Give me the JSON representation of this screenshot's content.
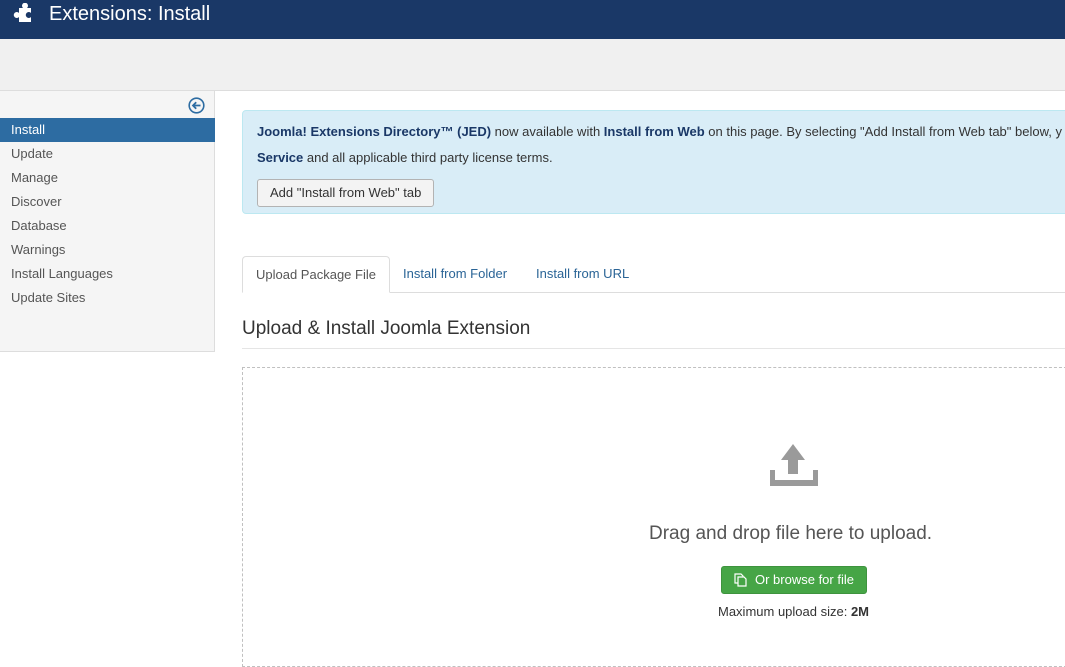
{
  "header": {
    "title": "Extensions: Install",
    "icon": "puzzle-piece-icon"
  },
  "sidebar": {
    "toggle_icon": "collapse-left-icon",
    "items": [
      {
        "label": "Install",
        "active": true
      },
      {
        "label": "Update"
      },
      {
        "label": "Manage"
      },
      {
        "label": "Discover"
      },
      {
        "label": "Database"
      },
      {
        "label": "Warnings"
      },
      {
        "label": "Install Languages"
      },
      {
        "label": "Update Sites"
      }
    ]
  },
  "alert": {
    "jed_name": "Joomla! Extensions Directory™ (JED)",
    "text_a": " now available with ",
    "install_from_web": "Install from Web",
    "text_b": " on this page. By selecting \"Add Install from Web tab\" below, y",
    "service": "Service",
    "text_c": " and all applicable third party license terms.",
    "button_label": "Add \"Install from Web\" tab"
  },
  "tabs": [
    {
      "label": "Upload Package File",
      "active": true
    },
    {
      "label": "Install from Folder"
    },
    {
      "label": "Install from URL"
    }
  ],
  "upload": {
    "title": "Upload & Install Joomla Extension",
    "icon": "upload-icon",
    "drag_text": "Drag and drop file here to upload.",
    "browse_button": "Or browse for file",
    "browse_icon": "copy-file-icon",
    "max_size_label": "Maximum upload size: ",
    "max_size_value": "2M"
  },
  "colors": {
    "header_bg": "#1a3867",
    "sidebar_active": "#2d6ca2",
    "alert_bg": "#d9edf7",
    "browse_button_bg": "#46a546"
  }
}
